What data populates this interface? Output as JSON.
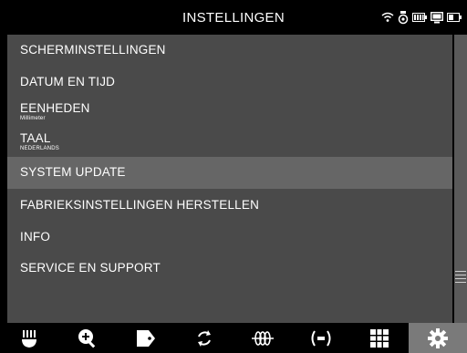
{
  "header": {
    "title": "INSTELLINGEN"
  },
  "status_icons": [
    "wifi-icon",
    "camera-icon",
    "battery-icon",
    "display-icon",
    "battery-icon"
  ],
  "menu": {
    "items": [
      {
        "label": "SCHERMINSTELLINGEN",
        "sub": ""
      },
      {
        "label": "DATUM EN TIJD",
        "sub": ""
      },
      {
        "label": "EENHEDEN",
        "sub": "Millimeter"
      },
      {
        "label": "TAAL",
        "sub": "NEDERLANDS"
      },
      {
        "label": "SYSTEM UPDATE",
        "sub": ""
      },
      {
        "label": "FABRIEKSINSTELLINGEN HERSTELLEN",
        "sub": ""
      },
      {
        "label": "INFO",
        "sub": ""
      },
      {
        "label": "SERVICE EN SUPPORT",
        "sub": ""
      }
    ],
    "selected_index": 4
  },
  "toolbar": {
    "items": [
      "probe-icon",
      "zoom-in-icon",
      "tag-icon",
      "rotate-icon",
      "coil-icon",
      "locate-icon",
      "grid-icon",
      "settings-icon"
    ],
    "active": "settings-icon"
  },
  "colors": {
    "background": "#000000",
    "panel": "#4a4a4a",
    "selected": "#666666",
    "active_tool": "#7a7a7a"
  }
}
